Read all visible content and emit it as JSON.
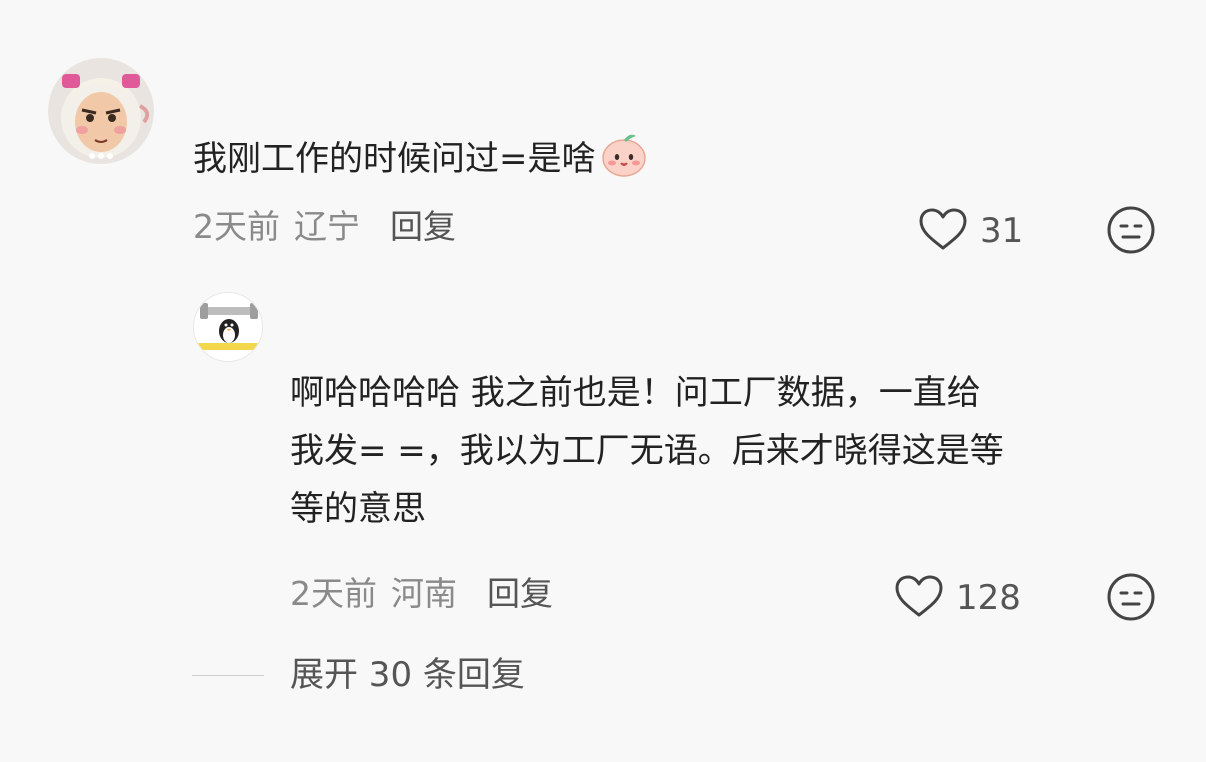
{
  "comments": [
    {
      "text": "我刚工作的时候问过=是啥",
      "emoji": "peach-face-emoji",
      "time": "2天前",
      "location": "辽宁",
      "reply_label": "回复",
      "likes": "31"
    },
    {
      "text_lines": [
        "啊哈哈哈哈 我之前也是！问工厂数据，一直给",
        "我发= =，我以为工厂无语。后来才晓得这是等",
        "等的意思"
      ],
      "time": "2天前",
      "location": "河南",
      "reply_label": "回复",
      "likes": "128"
    }
  ],
  "expand": {
    "label": "展开 30 条回复"
  },
  "icons": {
    "like": "heart-icon",
    "dislike": "meh-face-icon"
  },
  "colors": {
    "background": "#f8f8f8",
    "text_primary": "#222222",
    "text_secondary": "#8a8a8a",
    "text_action": "#555555"
  }
}
